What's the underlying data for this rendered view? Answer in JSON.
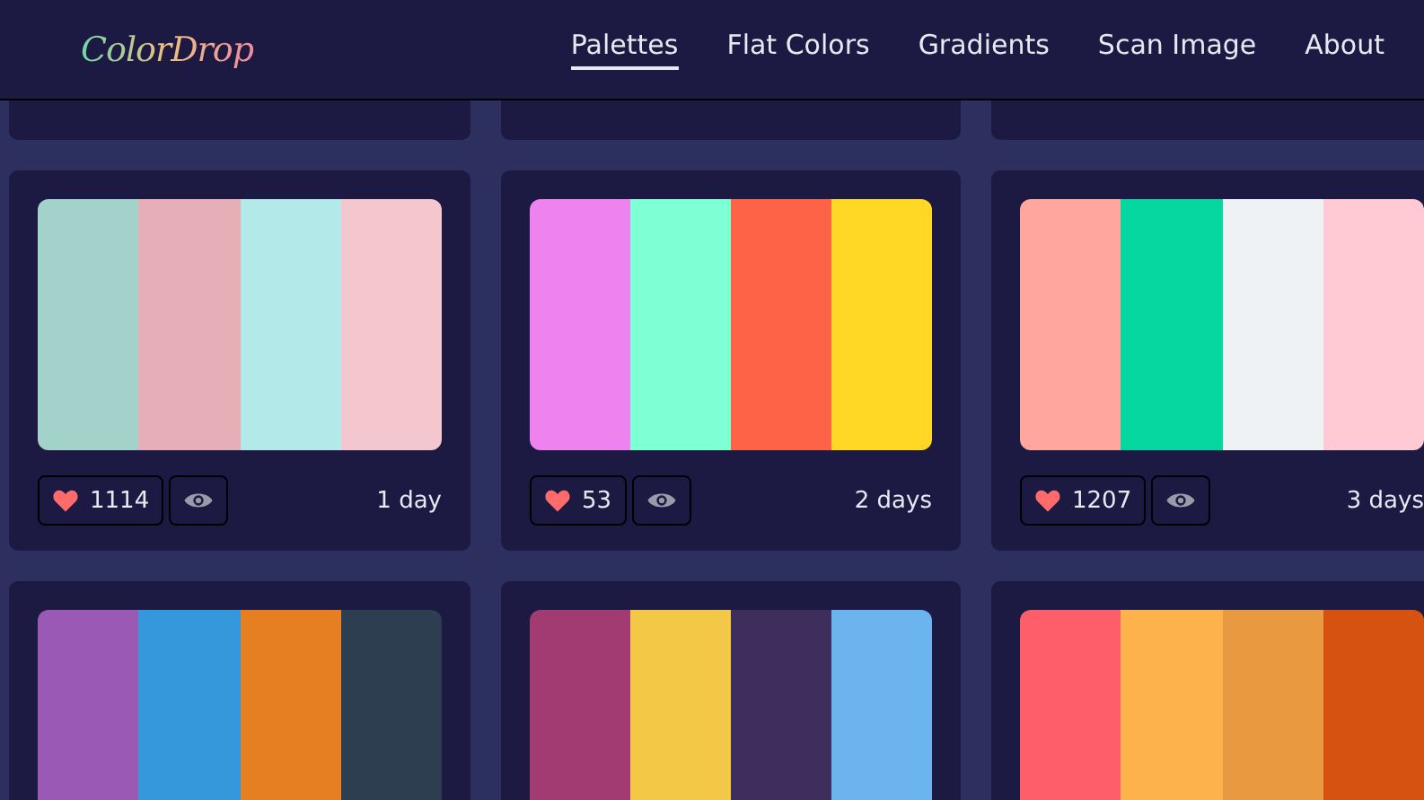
{
  "logo": "ColorDrop",
  "nav": [
    {
      "label": "Palettes",
      "selected": true
    },
    {
      "label": "Flat Colors",
      "selected": false
    },
    {
      "label": "Gradients",
      "selected": false
    },
    {
      "label": "Scan Image",
      "selected": false
    },
    {
      "label": "About",
      "selected": false
    }
  ],
  "palettes": [
    {
      "swatches": [
        {
          "color": "#a3d2ca"
        },
        {
          "color": "#e6aeb7"
        },
        {
          "color": "#b4e9ea"
        },
        {
          "color": "#f4c7cf"
        }
      ],
      "likes": "1114",
      "age": "1 day"
    },
    {
      "swatches": [
        {
          "color": "#ee82ee"
        },
        {
          "color": "#7fffd4"
        },
        {
          "color": "#ff6347"
        },
        {
          "color": "#ffd724"
        }
      ],
      "likes": "53",
      "age": "2 days"
    },
    {
      "swatches": [
        {
          "color": "#ffa69e"
        },
        {
          "color": "#06d6a0"
        },
        {
          "color": "#eef2f5"
        },
        {
          "color": "#ffcad4"
        }
      ],
      "likes": "1207",
      "age": "3 days"
    },
    {
      "swatches": [
        {
          "color": "#9b59b6"
        },
        {
          "color": "#3498db"
        },
        {
          "color": "#e67e22"
        },
        {
          "color": "#2c3e50"
        }
      ]
    },
    {
      "swatches": [
        {
          "color": "#a23b72"
        },
        {
          "color": "#f3c846"
        },
        {
          "color": "#3d2e5d"
        },
        {
          "color": "#6cb4ee"
        }
      ]
    },
    {
      "swatches": [
        {
          "color": "#fe5d6a"
        },
        {
          "color": "#feb24c"
        },
        {
          "color": "#e99a40"
        },
        {
          "color": "#d55210"
        }
      ]
    }
  ]
}
